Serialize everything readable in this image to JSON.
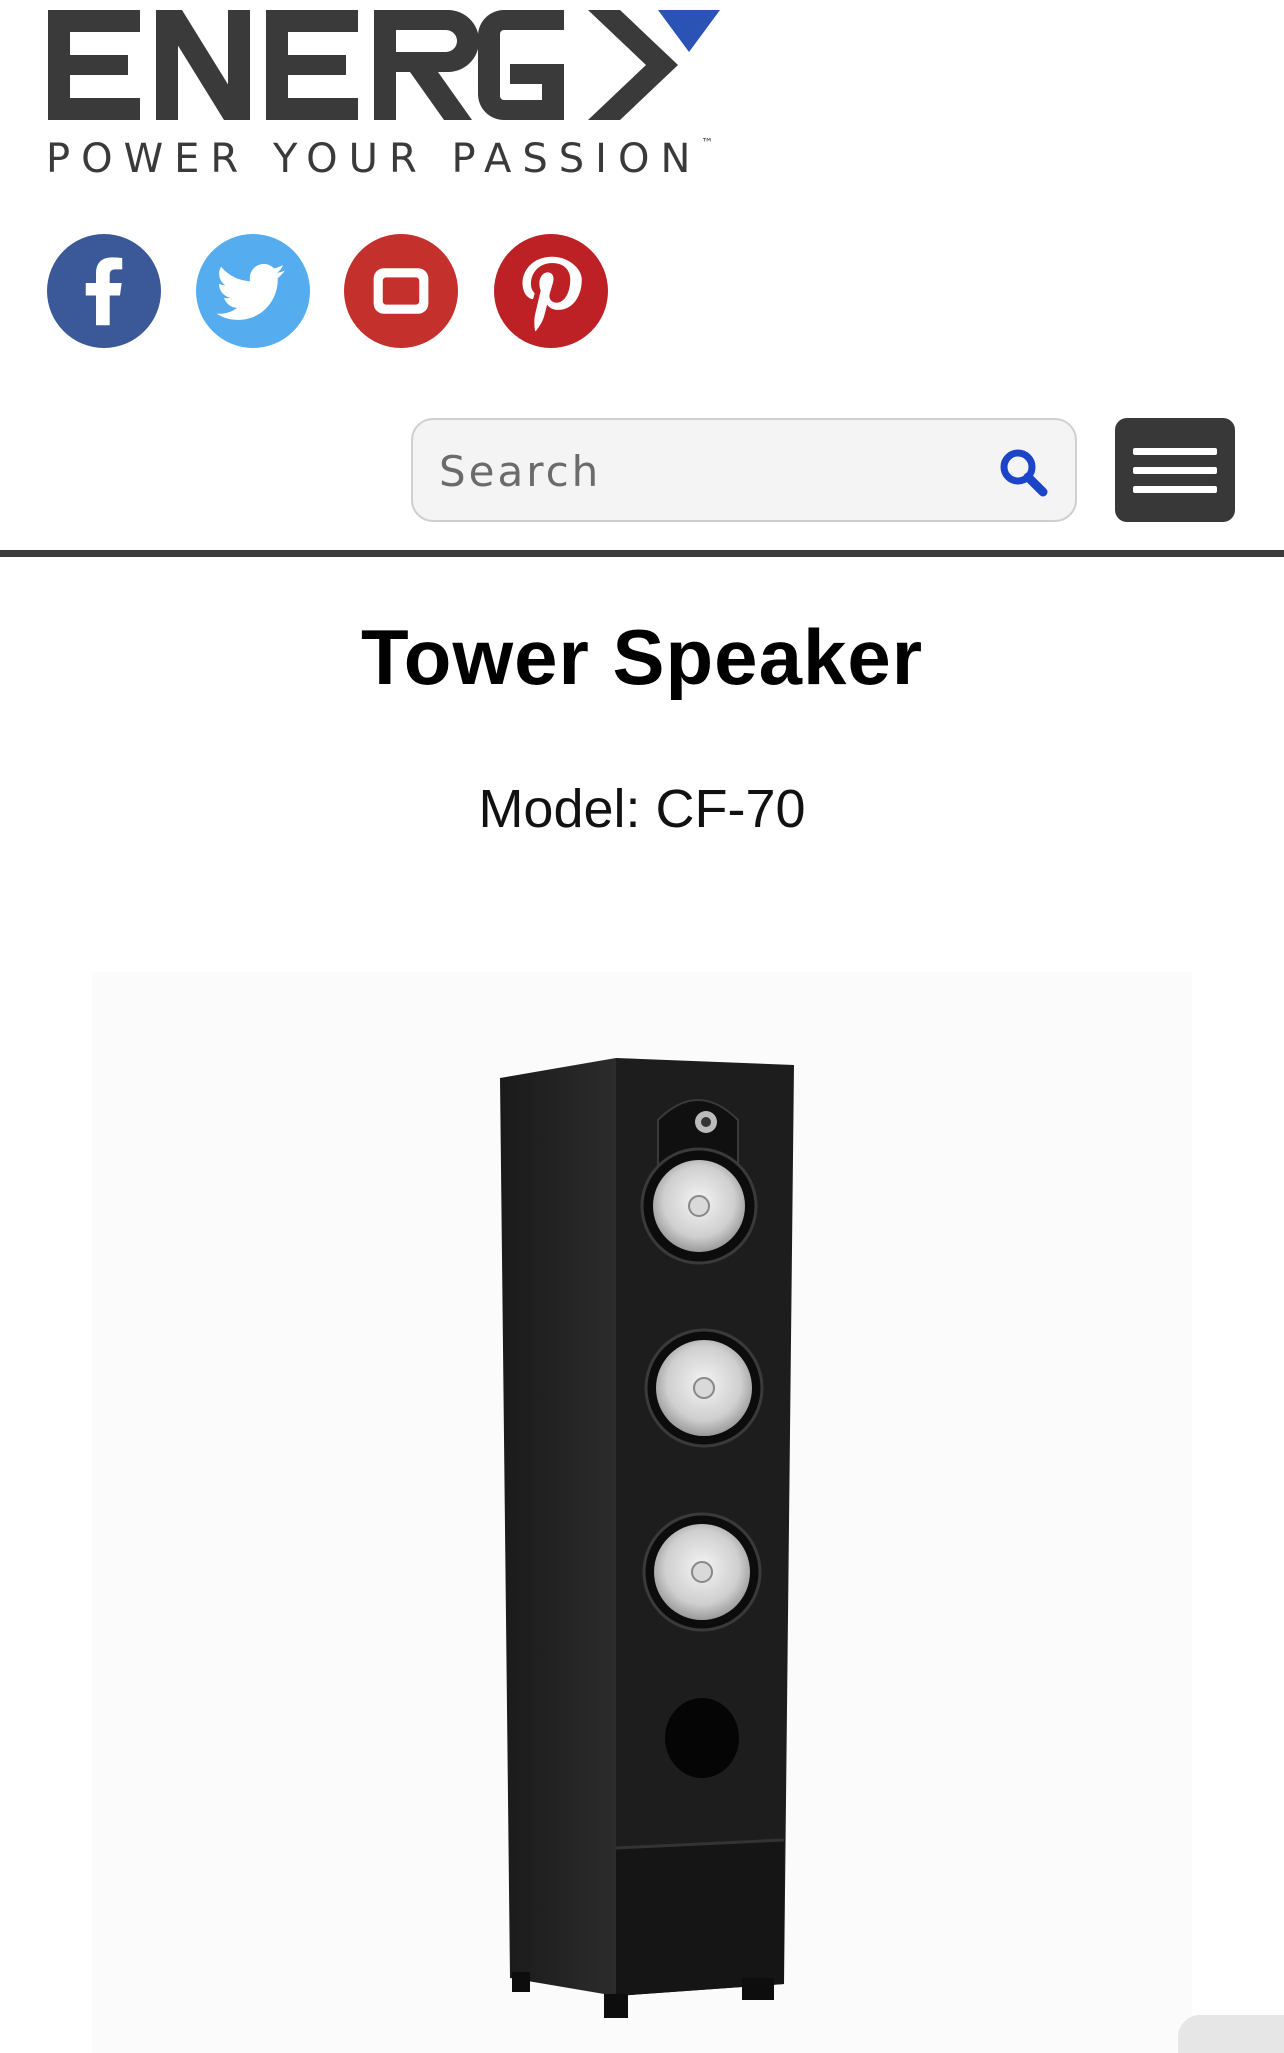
{
  "brand": {
    "logo_text": "ENERGY",
    "tagline": "POWER YOUR PASSION",
    "trademark": "™",
    "accent_color": "#2a53b5"
  },
  "social": [
    {
      "name": "facebook",
      "icon": "facebook-icon",
      "color": "#3b5998"
    },
    {
      "name": "twitter",
      "icon": "twitter-icon",
      "color": "#55acee"
    },
    {
      "name": "youtube",
      "icon": "youtube-icon",
      "color": "#c4302b"
    },
    {
      "name": "pinterest",
      "icon": "pinterest-icon",
      "color": "#bd2126"
    }
  ],
  "search": {
    "placeholder": "Search",
    "icon": "search-icon",
    "icon_color": "#1b44c8"
  },
  "menu": {
    "icon": "hamburger-menu-icon"
  },
  "product": {
    "title": "Tower Speaker",
    "model": "Model: CF-70",
    "image_alt": "Energy CF-70 tower speaker"
  }
}
